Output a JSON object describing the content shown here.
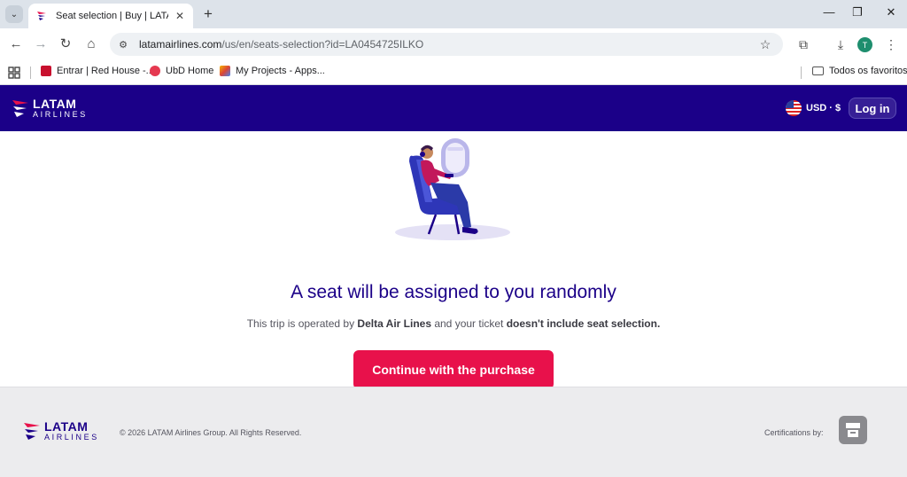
{
  "browser": {
    "tab": {
      "title": "Seat selection | Buy | LATAM Air",
      "close": "✕"
    },
    "new_tab": "+",
    "window_controls": {
      "minimize": "—",
      "restore": "❐",
      "close": "✕"
    },
    "url_host": "latamairlines.com",
    "url_path": "/us/en/seats-selection?id=LA0454725ILKO",
    "profile_initial": "T",
    "bookmarks": [
      {
        "label": "Entrar | Red House -...",
        "icon_color": "#c8102e"
      },
      {
        "label": "UbD Home",
        "icon_color": "#e53950"
      },
      {
        "label": "My Projects - Apps...",
        "icon_color": "#f4b400"
      }
    ],
    "bookmarks_folder": "Todos os favoritos"
  },
  "header": {
    "logo_main": "LATAM",
    "logo_sub": "AIRLINES",
    "currency": "USD · $",
    "login": "Log in"
  },
  "main": {
    "headline": "A seat will be assigned to you randomly",
    "subtext_prefix": "This trip is operated by ",
    "operator": "Delta Air Lines",
    "subtext_middle": " and your ticket ",
    "subtext_bold": "doesn't include seat selection.",
    "cta": "Continue with the purchase"
  },
  "footer": {
    "logo_main": "LATAM",
    "logo_sub": "AIRLINES",
    "copyright": "© 2026 LATAM Airlines Group. All Rights Reserved.",
    "certifications_label": "Certifications by:"
  },
  "colors": {
    "brand_indigo": "#1b0088",
    "cta_red": "#e8114b",
    "footer_bg": "#ececee"
  }
}
